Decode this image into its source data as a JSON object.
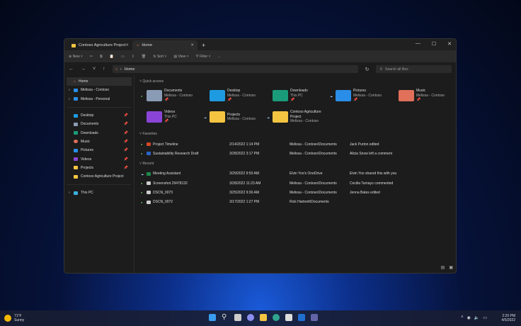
{
  "tabs": [
    {
      "label": "Contoso Agriculture Project"
    },
    {
      "label": "Home"
    }
  ],
  "toolbar": {
    "new": "New",
    "sort": "Sort",
    "view": "View",
    "filter": "Filter",
    "more": "..."
  },
  "address": {
    "path": "Home",
    "search_placeholder": "Search all files"
  },
  "sidebar": {
    "items": [
      {
        "label": "Home"
      },
      {
        "label": "Melissa - Contoso"
      },
      {
        "label": "Melissa - Personal"
      },
      {
        "label": "Desktop"
      },
      {
        "label": "Documents"
      },
      {
        "label": "Downloads"
      },
      {
        "label": "Music"
      },
      {
        "label": "Pictures"
      },
      {
        "label": "Videos"
      },
      {
        "label": "Projects"
      },
      {
        "label": "Contoso Agriculture Project"
      },
      {
        "label": "This PC"
      }
    ]
  },
  "quick_access": {
    "title": "Quick access",
    "items": [
      {
        "name": "Documents",
        "sub": "Melissa - Contoso",
        "color": "#8a9bb5"
      },
      {
        "name": "Desktop",
        "sub": "Melissa - Contoso",
        "color": "#1e9be0"
      },
      {
        "name": "Downloads",
        "sub": "This PC",
        "color": "#1a9c7a"
      },
      {
        "name": "Pictures",
        "sub": "Melissa - Contoso",
        "color": "#2a8ee8"
      },
      {
        "name": "Music",
        "sub": "Melissa - Contoso",
        "color": "#e0705a"
      },
      {
        "name": "Videos",
        "sub": "This PC",
        "color": "#8b45d6"
      },
      {
        "name": "Projects",
        "sub": "Melissa - Contoso",
        "color": "#f5c542"
      },
      {
        "name": "Contoso Agriculture Project",
        "sub": "Melissa - Contoso",
        "color": "#f5c542"
      }
    ]
  },
  "favorites": {
    "title": "Favorites",
    "rows": [
      {
        "name": "Project Timeline",
        "date": "2/14/2022 1:14 PM",
        "location": "Melissa - Contoso\\Documents",
        "activity": "Jack Purton edited",
        "color": "#d24726"
      },
      {
        "name": "Sustainability Research Draft",
        "date": "3/28/2022 3:17 PM",
        "location": "Melissa - Contoso\\Documents",
        "activity": "Alicia Snow left a comment",
        "color": "#2b65c9"
      }
    ]
  },
  "recent": {
    "title": "Recent",
    "rows": [
      {
        "name": "Meeting Assistant",
        "date": "3/29/2022 9:50 AM",
        "location": "Elvin Yoo's OneDrive",
        "activity": "Elvin Yoo shared this with you",
        "color": "#1d8a4a"
      },
      {
        "name": "Screenshot 29478132",
        "date": "3/28/2022 11:23 AM",
        "location": "Melissa - Contoso\\Documents",
        "activity": "Cecilia Tamayo commented",
        "color": "#ccc"
      },
      {
        "name": "DSCN_0073",
        "date": "3/25/2022 9:36 AM",
        "location": "Melissa - Contoso\\Documents",
        "activity": "Jenna Bates edited",
        "color": "#ccc"
      },
      {
        "name": "DSCN_0072",
        "date": "3/17/2022 1:27 PM",
        "location": "Rick Hartnett\\Documents",
        "activity": "",
        "color": "#ccc"
      }
    ]
  },
  "taskbar": {
    "temp": "71°F",
    "weather": "Sunny",
    "time": "2:20 PM",
    "date": "4/5/2022"
  }
}
